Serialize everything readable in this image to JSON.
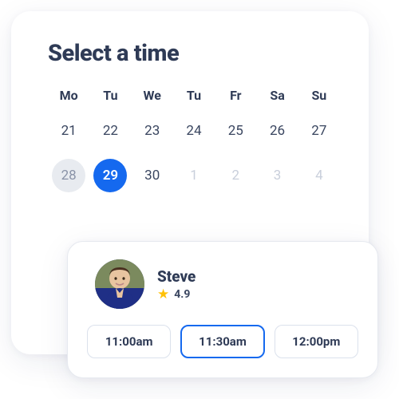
{
  "title": "Select a time",
  "weekdays": [
    "Mo",
    "Tu",
    "We",
    "Tu",
    "Fr",
    "Sa",
    "Su"
  ],
  "dates": [
    {
      "n": "21",
      "state": "normal"
    },
    {
      "n": "22",
      "state": "normal"
    },
    {
      "n": "23",
      "state": "normal"
    },
    {
      "n": "24",
      "state": "normal"
    },
    {
      "n": "25",
      "state": "normal"
    },
    {
      "n": "26",
      "state": "normal"
    },
    {
      "n": "27",
      "state": "normal"
    },
    {
      "n": "28",
      "state": "past"
    },
    {
      "n": "29",
      "state": "selected"
    },
    {
      "n": "30",
      "state": "normal"
    },
    {
      "n": "1",
      "state": "other-month"
    },
    {
      "n": "2",
      "state": "other-month"
    },
    {
      "n": "3",
      "state": "other-month"
    },
    {
      "n": "4",
      "state": "other-month"
    }
  ],
  "provider": {
    "name": "Steve",
    "rating": "4.9"
  },
  "slots": [
    {
      "label": "11:00am",
      "state": "normal"
    },
    {
      "label": "11:30am",
      "state": "selected"
    },
    {
      "label": "12:00pm",
      "state": "normal"
    }
  ]
}
